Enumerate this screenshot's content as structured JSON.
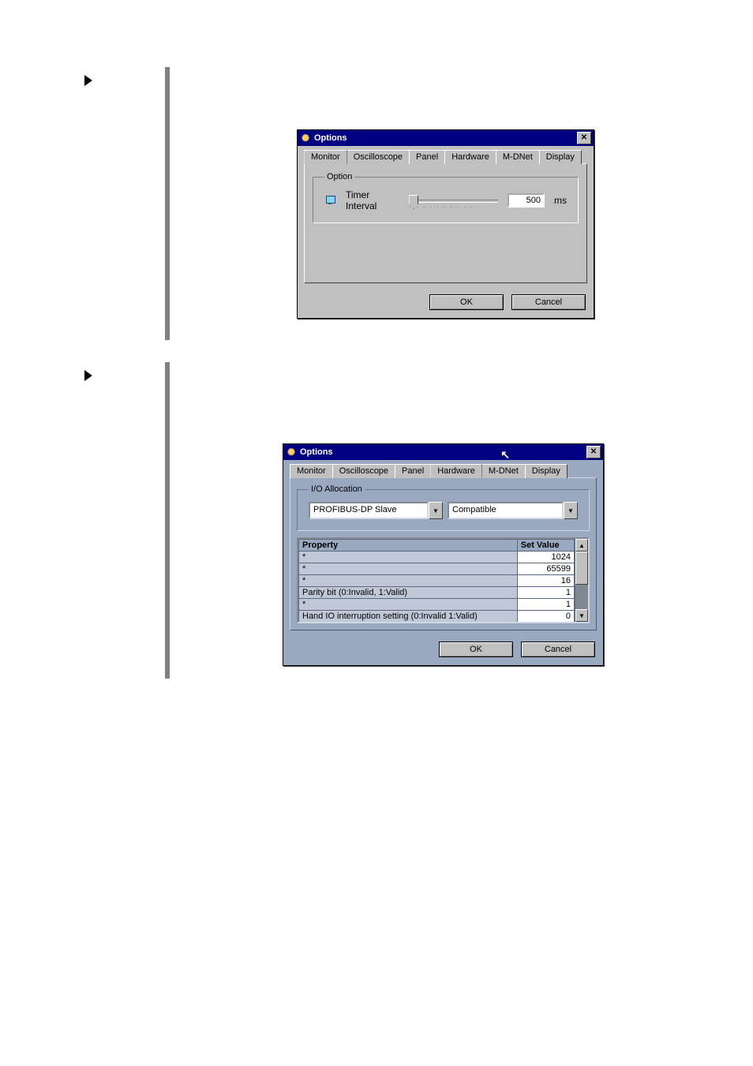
{
  "markers": {
    "marker1": "▶",
    "marker2": "▶"
  },
  "dlg1": {
    "title": "Options",
    "tabs": [
      "Monitor",
      "Oscilloscope",
      "Panel",
      "Hardware",
      "M-DNet",
      "Display"
    ],
    "active_tab": 0,
    "group_label": "Option",
    "timer_label": "Timer Interval",
    "timer_value": "500",
    "timer_unit": "ms",
    "ok": "OK",
    "cancel": "Cancel"
  },
  "dlg2": {
    "title": "Options",
    "tabs": [
      "Monitor",
      "Oscilloscope",
      "Panel",
      "Hardware",
      "M-DNet",
      "Display"
    ],
    "active_tab": 3,
    "group_label": "I/O Allocation",
    "left_select": "PROFIBUS-DP Slave",
    "right_select": "Compatible",
    "col_property": "Property",
    "col_value": "Set Value",
    "rows": [
      {
        "p": "*",
        "v": "1024"
      },
      {
        "p": "*",
        "v": "65599"
      },
      {
        "p": "*",
        "v": "16"
      },
      {
        "p": "Parity bit (0:Invalid, 1:Valid)",
        "v": "1"
      },
      {
        "p": "*",
        "v": "1"
      },
      {
        "p": "Hand IO  interruption setting (0:Invalid  1:Valid)",
        "v": "0"
      }
    ],
    "ok": "OK",
    "cancel": "Cancel"
  }
}
